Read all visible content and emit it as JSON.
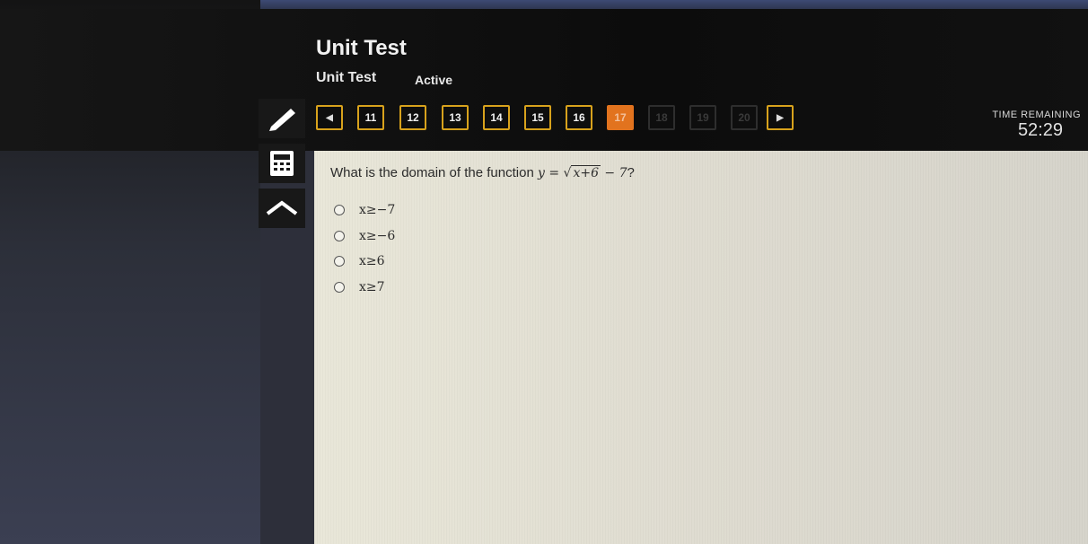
{
  "header": {
    "title": "Unit Test",
    "subtitle": "Unit Test",
    "status": "Active"
  },
  "question_nav": {
    "prev_icon": "left-arrow-icon",
    "next_icon": "right-arrow-icon",
    "items": [
      {
        "label": "11",
        "state": "normal"
      },
      {
        "label": "12",
        "state": "normal"
      },
      {
        "label": "13",
        "state": "normal"
      },
      {
        "label": "14",
        "state": "normal"
      },
      {
        "label": "15",
        "state": "normal"
      },
      {
        "label": "16",
        "state": "normal"
      },
      {
        "label": "17",
        "state": "current"
      },
      {
        "label": "18",
        "state": "dim"
      },
      {
        "label": "19",
        "state": "dim"
      },
      {
        "label": "20",
        "state": "dim"
      }
    ]
  },
  "timer": {
    "label": "TIME REMAINING",
    "value": "52:29"
  },
  "tools": [
    "pencil-icon",
    "calculator-icon",
    "up-arrow-icon"
  ],
  "question": {
    "prefix": "What is the domain of the function ",
    "func_lhs": "y = ",
    "radicand": "x+6",
    "func_rhs": " − 7",
    "suffix": "?",
    "options": [
      "x≥−7",
      "x≥−6",
      "x≥6",
      "x≥7"
    ]
  },
  "colors": {
    "accent": "#d8a21c",
    "current": "#e2731e",
    "panel": "#e5e3d7"
  }
}
